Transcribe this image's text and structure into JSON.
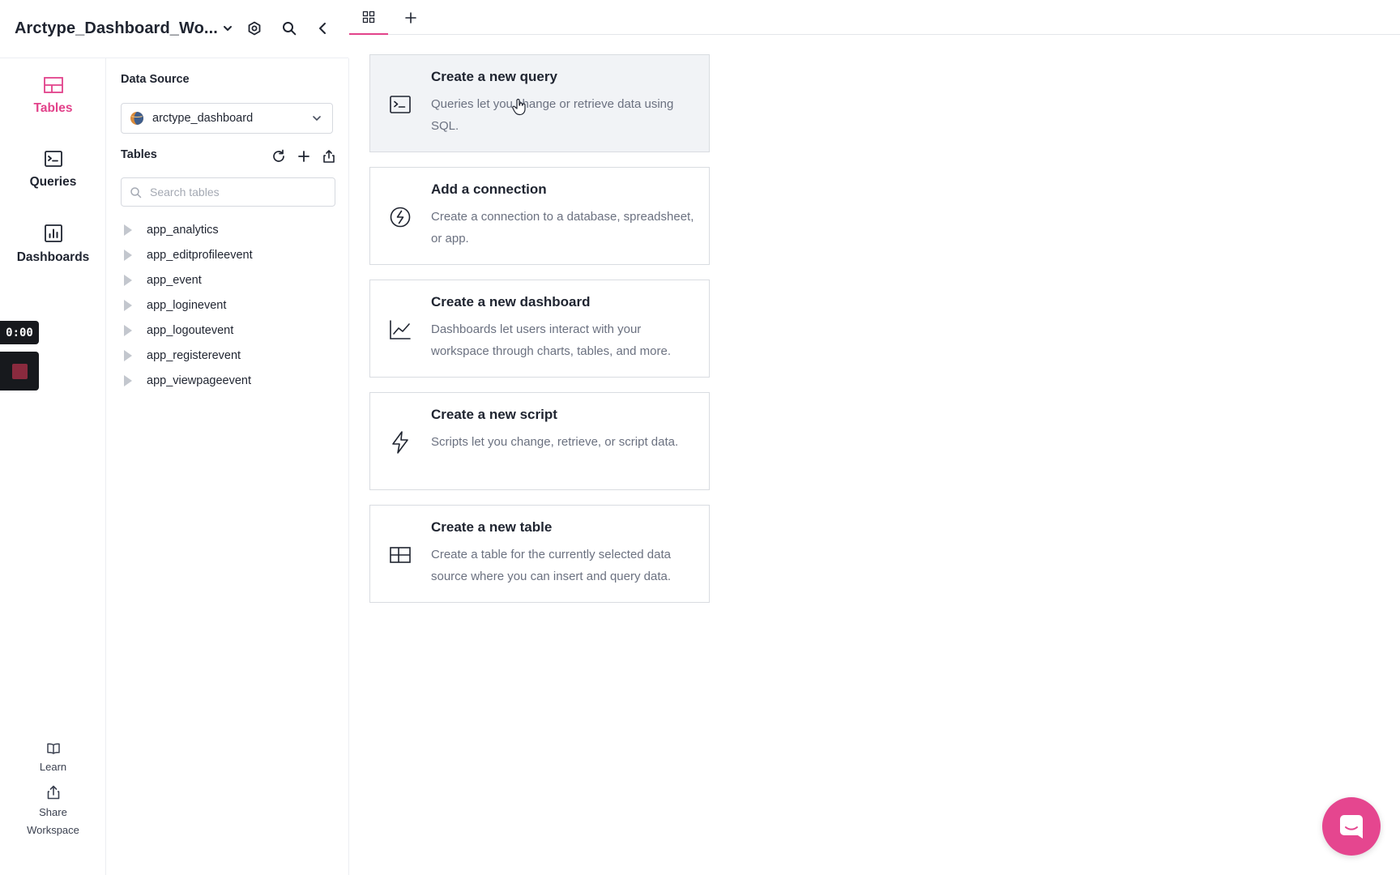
{
  "workspace": {
    "title": "Arctype_Dashboard_Wo..."
  },
  "header_icons": [
    "chevron-down-icon",
    "settings-icon",
    "search-icon",
    "collapse-chevron-icon"
  ],
  "rail": {
    "items": [
      {
        "label": "Tables",
        "icon": "table-icon",
        "active": true
      },
      {
        "label": "Queries",
        "icon": "terminal-icon",
        "active": false
      },
      {
        "label": "Dashboards",
        "icon": "bar-chart-icon",
        "active": false
      }
    ],
    "bottom": [
      {
        "label": "Learn",
        "icon": "book-icon"
      },
      {
        "label": "Share Workspace",
        "icon": "share-icon"
      }
    ]
  },
  "recording": {
    "time": "0:00"
  },
  "panel": {
    "data_source_label": "Data Source",
    "data_source_value": "arctype_dashboard",
    "tables_label": "Tables",
    "search_placeholder": "Search tables",
    "tables": [
      "app_analytics",
      "app_editprofileevent",
      "app_event",
      "app_loginevent",
      "app_logoutevent",
      "app_registerevent",
      "app_viewpageevent"
    ]
  },
  "cards": [
    {
      "title": "Create a new query",
      "description": "Queries let you change or retrieve data using SQL.",
      "icon": "terminal-icon"
    },
    {
      "title": "Add a connection",
      "description": "Create a connection to a database, spreadsheet, or app.",
      "icon": "connection-icon"
    },
    {
      "title": "Create a new dashboard",
      "description": "Dashboards let users interact with your workspace through charts, tables, and more.",
      "icon": "line-chart-icon"
    },
    {
      "title": "Create a new script",
      "description": "Scripts let you change, retrieve, or script data.",
      "icon": "lightning-icon"
    },
    {
      "title": "Create a new table",
      "description": "Create a table for the currently selected data source where you can insert and query data.",
      "icon": "table-icon"
    }
  ],
  "colors": {
    "accent": "#e2428a",
    "chat": "#e5468f",
    "text": "#1f2430",
    "muted": "#6b7180",
    "border": "#d9dce1"
  }
}
